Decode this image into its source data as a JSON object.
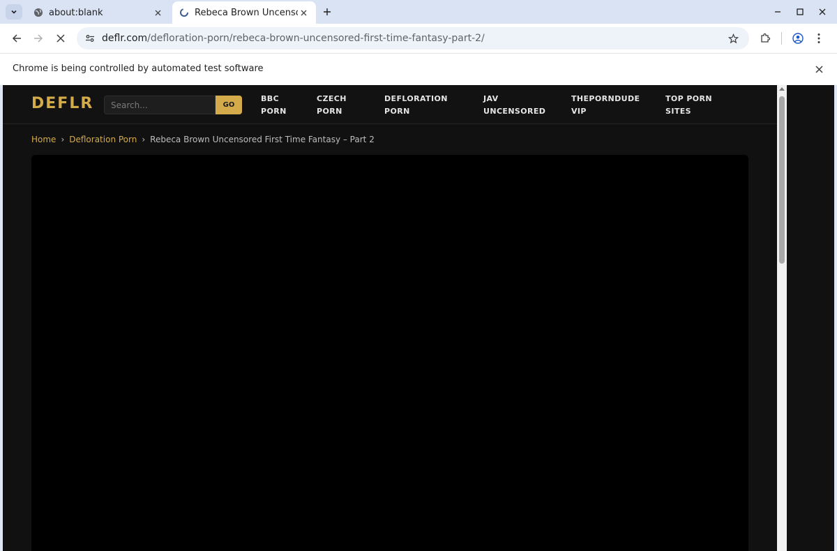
{
  "browser": {
    "tabs": [
      {
        "title": "about:blank",
        "active": false
      },
      {
        "title": "Rebeca Brown Uncensore",
        "active": true
      }
    ],
    "url_host": "deflr.com",
    "url_path": "/defloration-porn/rebeca-brown-uncensored-first-time-fantasy-part-2/",
    "infobar_message": "Chrome is being controlled by automated test software"
  },
  "site": {
    "logo": "DEFLR",
    "search_placeholder": "Search...",
    "search_button": "GO",
    "nav": [
      "BBC\nPORN",
      "CZECH\nPORN",
      "DEFLORATION\nPORN",
      "JAV\nUNCENSORED",
      "THEPORNDUDE\nVIP",
      "TOP PORN\nSITES"
    ],
    "breadcrumb": {
      "home": "Home",
      "category": "Defloration Porn",
      "current": "Rebeca Brown Uncensored First Time Fantasy – Part 2",
      "separator": "›"
    }
  },
  "colors": {
    "accent": "#d4ab4a",
    "page_bg": "#111111",
    "player_bg": "#000000"
  }
}
